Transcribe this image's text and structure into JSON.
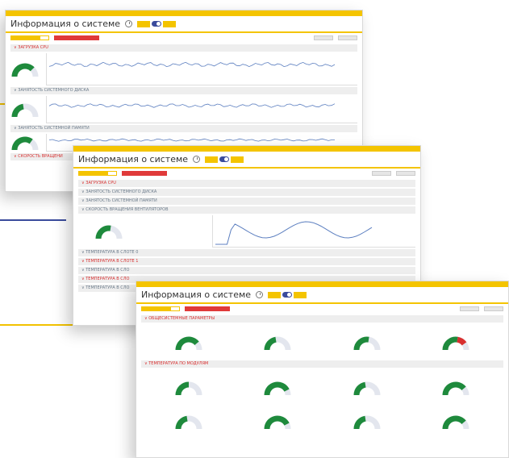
{
  "colors": {
    "accent": "#f4c400",
    "alert": "#d83030",
    "ok": "#1e8a3c",
    "gauge_bg": "#e3e6ee",
    "line": "#5c7fc0"
  },
  "app": {
    "title": "Информация о системе"
  },
  "screens": [
    {
      "sections": [
        {
          "label": "ЗАГРУЗКА CPU",
          "alert": true,
          "expanded": true
        },
        {
          "label": "ЗАНЯТОСТЬ СИСТЕМНОГО ДИСКА",
          "alert": false,
          "expanded": true
        },
        {
          "label": "ЗАНЯТОСТЬ СИСТЕМНОЙ ПАМЯТИ",
          "alert": false,
          "expanded": true
        },
        {
          "label": "СКОРОСТЬ ВРАЩЕНИ",
          "alert": true,
          "expanded": false
        }
      ]
    },
    {
      "sections": [
        {
          "label": "ЗАГРУЗКА CPU",
          "alert": true
        },
        {
          "label": "ЗАНЯТОСТЬ СИСТЕМНОГО ДИСКА",
          "alert": false
        },
        {
          "label": "ЗАНЯТОСТЬ СИСТЕМНОЙ ПАМЯТИ",
          "alert": false
        },
        {
          "label": "СКОРОСТЬ ВРАЩЕНИЯ ВЕНТИЛЯТОРОВ",
          "alert": false
        },
        {
          "label": "ТЕМПЕРАТУРА В СЛОТЕ 0",
          "alert": false
        },
        {
          "label": "ТЕМПЕРАТУРА В СЛОТЕ 1",
          "alert": true
        },
        {
          "label": "ТЕМПЕРАТУРА В СЛО",
          "alert": false
        },
        {
          "label": "ТЕМПЕРАТУРА В СЛО",
          "alert": true
        },
        {
          "label": "ТЕМПЕРАТУРА В СЛО",
          "alert": false
        }
      ]
    },
    {
      "sections": [
        {
          "label": "ОБЩЕСИСТЕМНЫЕ ПАРАМЕТРЫ",
          "alert": true
        },
        {
          "label": "ТЕМПЕРАТУРА ПО МОДУЛЯМ",
          "alert": true
        }
      ]
    }
  ],
  "gauges": {
    "s1": [
      0.75,
      0.45,
      0.7
    ],
    "s2": [
      0.55
    ],
    "s3": [
      0.78,
      0.45,
      0.55,
      0.8,
      0.5,
      0.85,
      0.45,
      0.78,
      0.45,
      0.85,
      0.45,
      0.78
    ]
  }
}
